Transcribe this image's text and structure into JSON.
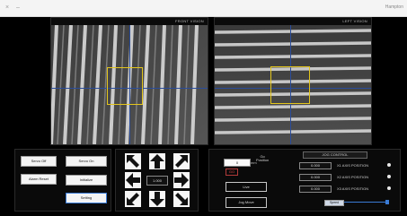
{
  "window": {
    "app_title": "Hampton"
  },
  "cameras": {
    "front": {
      "title": "FRONT VISION"
    },
    "left": {
      "title": "LEFT VISION"
    }
  },
  "buttons": {
    "servo_off": "Servo Off",
    "servo_on": "Servo On",
    "alarm_reset": "Alarm Reset",
    "initialize": "Initialize",
    "setting": "Setting"
  },
  "jog": {
    "step_value": "1.000"
  },
  "control": {
    "header": "JOG CONTROL",
    "position_label_line1": "Go",
    "position_label_line2": "Position",
    "position_value": "0",
    "mm_button": "mm",
    "go_button": "GO",
    "live_button": "Live",
    "jog_move_button": "Jog Move",
    "axes": [
      {
        "value": "0.000",
        "label": "X1 AXIS POSITION"
      },
      {
        "value": "0.000",
        "label": "X2 AXIS POSITION"
      },
      {
        "value": "0.000",
        "label": "X3 AXIS POSITION"
      }
    ],
    "speed_label": "Speed"
  },
  "icons": {
    "up_left": "arrow-up-left-icon",
    "up": "arrow-up-icon",
    "up_right": "arrow-up-right-icon",
    "left": "arrow-left-icon",
    "right": "arrow-right-icon",
    "down_left": "arrow-down-left-icon",
    "down": "arrow-down-icon",
    "down_right": "arrow-down-right-icon"
  },
  "colors": {
    "roi": "#e3c51c",
    "crosshair": "#2a4c9a",
    "background": "#000000"
  }
}
